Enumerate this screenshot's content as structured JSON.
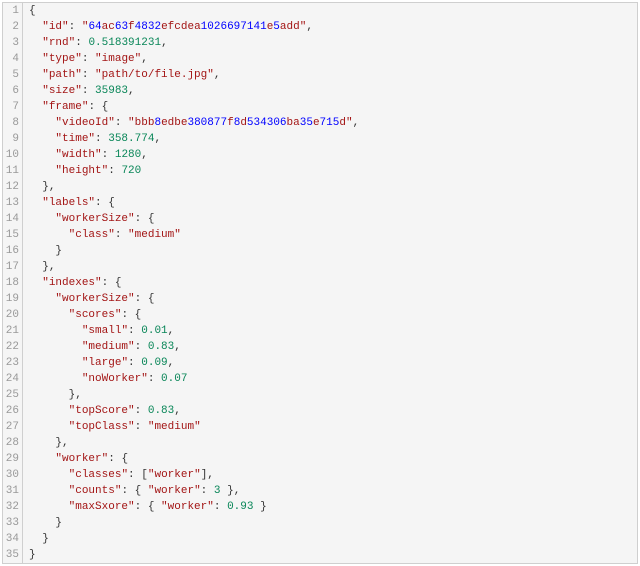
{
  "lines": [
    {
      "indent": 0,
      "tokens": [
        {
          "t": "{",
          "cls": "p"
        }
      ]
    },
    {
      "indent": 1,
      "tokens": [
        {
          "t": "\"",
          "cls": "k"
        },
        {
          "t": "id",
          "cls": "k"
        },
        {
          "t": "\"",
          "cls": "k"
        },
        {
          "t": ": ",
          "cls": "c"
        },
        {
          "t": "\"",
          "cls": "s"
        },
        {
          "t": "64",
          "cls": "hx"
        },
        {
          "t": "ac",
          "cls": "s"
        },
        {
          "t": "63",
          "cls": "hx"
        },
        {
          "t": "f",
          "cls": "s"
        },
        {
          "t": "4832",
          "cls": "hx"
        },
        {
          "t": "efcdea",
          "cls": "s"
        },
        {
          "t": "1026697141",
          "cls": "hx"
        },
        {
          "t": "e",
          "cls": "s"
        },
        {
          "t": "5",
          "cls": "hx"
        },
        {
          "t": "add",
          "cls": "s"
        },
        {
          "t": "\"",
          "cls": "s"
        },
        {
          "t": ",",
          "cls": "p"
        }
      ]
    },
    {
      "indent": 1,
      "tokens": [
        {
          "t": "\"",
          "cls": "k"
        },
        {
          "t": "rnd",
          "cls": "k"
        },
        {
          "t": "\"",
          "cls": "k"
        },
        {
          "t": ": ",
          "cls": "c"
        },
        {
          "t": "0.518391231",
          "cls": "n"
        },
        {
          "t": ",",
          "cls": "p"
        }
      ]
    },
    {
      "indent": 1,
      "tokens": [
        {
          "t": "\"",
          "cls": "k"
        },
        {
          "t": "type",
          "cls": "k"
        },
        {
          "t": "\"",
          "cls": "k"
        },
        {
          "t": ": ",
          "cls": "c"
        },
        {
          "t": "\"",
          "cls": "s"
        },
        {
          "t": "image",
          "cls": "s"
        },
        {
          "t": "\"",
          "cls": "s"
        },
        {
          "t": ",",
          "cls": "p"
        }
      ]
    },
    {
      "indent": 1,
      "tokens": [
        {
          "t": "\"",
          "cls": "k"
        },
        {
          "t": "path",
          "cls": "k"
        },
        {
          "t": "\"",
          "cls": "k"
        },
        {
          "t": ": ",
          "cls": "c"
        },
        {
          "t": "\"",
          "cls": "s"
        },
        {
          "t": "path/to/file.jpg",
          "cls": "s"
        },
        {
          "t": "\"",
          "cls": "s"
        },
        {
          "t": ",",
          "cls": "p"
        }
      ]
    },
    {
      "indent": 1,
      "tokens": [
        {
          "t": "\"",
          "cls": "k"
        },
        {
          "t": "size",
          "cls": "k"
        },
        {
          "t": "\"",
          "cls": "k"
        },
        {
          "t": ": ",
          "cls": "c"
        },
        {
          "t": "35983",
          "cls": "n"
        },
        {
          "t": ",",
          "cls": "p"
        }
      ]
    },
    {
      "indent": 1,
      "tokens": [
        {
          "t": "\"",
          "cls": "k"
        },
        {
          "t": "frame",
          "cls": "k"
        },
        {
          "t": "\"",
          "cls": "k"
        },
        {
          "t": ": ",
          "cls": "c"
        },
        {
          "t": "{",
          "cls": "p"
        }
      ]
    },
    {
      "indent": 2,
      "tokens": [
        {
          "t": "\"",
          "cls": "k"
        },
        {
          "t": "videoId",
          "cls": "k"
        },
        {
          "t": "\"",
          "cls": "k"
        },
        {
          "t": ": ",
          "cls": "c"
        },
        {
          "t": "\"",
          "cls": "s"
        },
        {
          "t": "bbb",
          "cls": "s"
        },
        {
          "t": "8",
          "cls": "hx"
        },
        {
          "t": "edbe",
          "cls": "s"
        },
        {
          "t": "380877",
          "cls": "hx"
        },
        {
          "t": "f",
          "cls": "s"
        },
        {
          "t": "8",
          "cls": "hx"
        },
        {
          "t": "d",
          "cls": "s"
        },
        {
          "t": "534306",
          "cls": "hx"
        },
        {
          "t": "ba",
          "cls": "s"
        },
        {
          "t": "35",
          "cls": "hx"
        },
        {
          "t": "e",
          "cls": "s"
        },
        {
          "t": "715",
          "cls": "hx"
        },
        {
          "t": "d",
          "cls": "s"
        },
        {
          "t": "\"",
          "cls": "s"
        },
        {
          "t": ",",
          "cls": "p"
        }
      ]
    },
    {
      "indent": 2,
      "tokens": [
        {
          "t": "\"",
          "cls": "k"
        },
        {
          "t": "time",
          "cls": "k"
        },
        {
          "t": "\"",
          "cls": "k"
        },
        {
          "t": ": ",
          "cls": "c"
        },
        {
          "t": "358.774",
          "cls": "n"
        },
        {
          "t": ",",
          "cls": "p"
        }
      ]
    },
    {
      "indent": 2,
      "tokens": [
        {
          "t": "\"",
          "cls": "k"
        },
        {
          "t": "width",
          "cls": "k"
        },
        {
          "t": "\"",
          "cls": "k"
        },
        {
          "t": ": ",
          "cls": "c"
        },
        {
          "t": "1280",
          "cls": "n"
        },
        {
          "t": ",",
          "cls": "p"
        }
      ]
    },
    {
      "indent": 2,
      "tokens": [
        {
          "t": "\"",
          "cls": "k"
        },
        {
          "t": "height",
          "cls": "k"
        },
        {
          "t": "\"",
          "cls": "k"
        },
        {
          "t": ": ",
          "cls": "c"
        },
        {
          "t": "720",
          "cls": "n"
        }
      ]
    },
    {
      "indent": 1,
      "tokens": [
        {
          "t": "}",
          "cls": "p"
        },
        {
          "t": ",",
          "cls": "p"
        }
      ]
    },
    {
      "indent": 1,
      "tokens": [
        {
          "t": "\"",
          "cls": "k"
        },
        {
          "t": "labels",
          "cls": "k"
        },
        {
          "t": "\"",
          "cls": "k"
        },
        {
          "t": ": ",
          "cls": "c"
        },
        {
          "t": "{",
          "cls": "p"
        }
      ]
    },
    {
      "indent": 2,
      "tokens": [
        {
          "t": "\"",
          "cls": "k"
        },
        {
          "t": "workerSize",
          "cls": "k"
        },
        {
          "t": "\"",
          "cls": "k"
        },
        {
          "t": ": ",
          "cls": "c"
        },
        {
          "t": "{",
          "cls": "p"
        }
      ]
    },
    {
      "indent": 3,
      "tokens": [
        {
          "t": "\"",
          "cls": "k"
        },
        {
          "t": "class",
          "cls": "k"
        },
        {
          "t": "\"",
          "cls": "k"
        },
        {
          "t": ": ",
          "cls": "c"
        },
        {
          "t": "\"",
          "cls": "s"
        },
        {
          "t": "medium",
          "cls": "s"
        },
        {
          "t": "\"",
          "cls": "s"
        }
      ]
    },
    {
      "indent": 2,
      "tokens": [
        {
          "t": "}",
          "cls": "p"
        }
      ]
    },
    {
      "indent": 1,
      "tokens": [
        {
          "t": "}",
          "cls": "p"
        },
        {
          "t": ",",
          "cls": "p"
        }
      ]
    },
    {
      "indent": 1,
      "tokens": [
        {
          "t": "\"",
          "cls": "k"
        },
        {
          "t": "indexes",
          "cls": "k"
        },
        {
          "t": "\"",
          "cls": "k"
        },
        {
          "t": ": ",
          "cls": "c"
        },
        {
          "t": "{",
          "cls": "p"
        }
      ]
    },
    {
      "indent": 2,
      "tokens": [
        {
          "t": "\"",
          "cls": "k"
        },
        {
          "t": "workerSize",
          "cls": "k"
        },
        {
          "t": "\"",
          "cls": "k"
        },
        {
          "t": ": ",
          "cls": "c"
        },
        {
          "t": "{",
          "cls": "p"
        }
      ]
    },
    {
      "indent": 3,
      "tokens": [
        {
          "t": "\"",
          "cls": "k"
        },
        {
          "t": "scores",
          "cls": "k"
        },
        {
          "t": "\"",
          "cls": "k"
        },
        {
          "t": ": ",
          "cls": "c"
        },
        {
          "t": "{",
          "cls": "p"
        }
      ]
    },
    {
      "indent": 4,
      "tokens": [
        {
          "t": "\"",
          "cls": "k"
        },
        {
          "t": "small",
          "cls": "k"
        },
        {
          "t": "\"",
          "cls": "k"
        },
        {
          "t": ": ",
          "cls": "c"
        },
        {
          "t": "0.01",
          "cls": "n"
        },
        {
          "t": ",",
          "cls": "p"
        }
      ]
    },
    {
      "indent": 4,
      "tokens": [
        {
          "t": "\"",
          "cls": "k"
        },
        {
          "t": "medium",
          "cls": "k"
        },
        {
          "t": "\"",
          "cls": "k"
        },
        {
          "t": ": ",
          "cls": "c"
        },
        {
          "t": "0.83",
          "cls": "n"
        },
        {
          "t": ",",
          "cls": "p"
        }
      ]
    },
    {
      "indent": 4,
      "tokens": [
        {
          "t": "\"",
          "cls": "k"
        },
        {
          "t": "large",
          "cls": "k"
        },
        {
          "t": "\"",
          "cls": "k"
        },
        {
          "t": ": ",
          "cls": "c"
        },
        {
          "t": "0.09",
          "cls": "n"
        },
        {
          "t": ",",
          "cls": "p"
        }
      ]
    },
    {
      "indent": 4,
      "tokens": [
        {
          "t": "\"",
          "cls": "k"
        },
        {
          "t": "noWorker",
          "cls": "k"
        },
        {
          "t": "\"",
          "cls": "k"
        },
        {
          "t": ": ",
          "cls": "c"
        },
        {
          "t": "0.07",
          "cls": "n"
        }
      ]
    },
    {
      "indent": 3,
      "tokens": [
        {
          "t": "}",
          "cls": "p"
        },
        {
          "t": ",",
          "cls": "p"
        }
      ]
    },
    {
      "indent": 3,
      "tokens": [
        {
          "t": "\"",
          "cls": "k"
        },
        {
          "t": "topScore",
          "cls": "k"
        },
        {
          "t": "\"",
          "cls": "k"
        },
        {
          "t": ": ",
          "cls": "c"
        },
        {
          "t": "0.83",
          "cls": "n"
        },
        {
          "t": ",",
          "cls": "p"
        }
      ]
    },
    {
      "indent": 3,
      "tokens": [
        {
          "t": "\"",
          "cls": "k"
        },
        {
          "t": "topClass",
          "cls": "k"
        },
        {
          "t": "\"",
          "cls": "k"
        },
        {
          "t": ": ",
          "cls": "c"
        },
        {
          "t": "\"",
          "cls": "s"
        },
        {
          "t": "medium",
          "cls": "s"
        },
        {
          "t": "\"",
          "cls": "s"
        }
      ]
    },
    {
      "indent": 2,
      "tokens": [
        {
          "t": "}",
          "cls": "p"
        },
        {
          "t": ",",
          "cls": "p"
        }
      ]
    },
    {
      "indent": 2,
      "tokens": [
        {
          "t": "\"",
          "cls": "k"
        },
        {
          "t": "worker",
          "cls": "k"
        },
        {
          "t": "\"",
          "cls": "k"
        },
        {
          "t": ": ",
          "cls": "c"
        },
        {
          "t": "{",
          "cls": "p"
        }
      ]
    },
    {
      "indent": 3,
      "tokens": [
        {
          "t": "\"",
          "cls": "k"
        },
        {
          "t": "classes",
          "cls": "k"
        },
        {
          "t": "\"",
          "cls": "k"
        },
        {
          "t": ": ",
          "cls": "c"
        },
        {
          "t": "[",
          "cls": "p"
        },
        {
          "t": "\"",
          "cls": "s"
        },
        {
          "t": "worker",
          "cls": "s"
        },
        {
          "t": "\"",
          "cls": "s"
        },
        {
          "t": "]",
          "cls": "p"
        },
        {
          "t": ",",
          "cls": "p"
        }
      ]
    },
    {
      "indent": 3,
      "tokens": [
        {
          "t": "\"",
          "cls": "k"
        },
        {
          "t": "counts",
          "cls": "k"
        },
        {
          "t": "\"",
          "cls": "k"
        },
        {
          "t": ": ",
          "cls": "c"
        },
        {
          "t": "{ ",
          "cls": "p"
        },
        {
          "t": "\"",
          "cls": "k"
        },
        {
          "t": "worker",
          "cls": "k"
        },
        {
          "t": "\"",
          "cls": "k"
        },
        {
          "t": ": ",
          "cls": "c"
        },
        {
          "t": "3",
          "cls": "n"
        },
        {
          "t": " }",
          "cls": "p"
        },
        {
          "t": ",",
          "cls": "p"
        }
      ]
    },
    {
      "indent": 3,
      "tokens": [
        {
          "t": "\"",
          "cls": "k"
        },
        {
          "t": "maxSxore",
          "cls": "k"
        },
        {
          "t": "\"",
          "cls": "k"
        },
        {
          "t": ": ",
          "cls": "c"
        },
        {
          "t": "{ ",
          "cls": "p"
        },
        {
          "t": "\"",
          "cls": "k"
        },
        {
          "t": "worker",
          "cls": "k"
        },
        {
          "t": "\"",
          "cls": "k"
        },
        {
          "t": ": ",
          "cls": "c"
        },
        {
          "t": "0.93",
          "cls": "n"
        },
        {
          "t": " }",
          "cls": "p"
        }
      ]
    },
    {
      "indent": 2,
      "tokens": [
        {
          "t": "}",
          "cls": "p"
        }
      ]
    },
    {
      "indent": 1,
      "tokens": [
        {
          "t": "}",
          "cls": "p"
        }
      ]
    },
    {
      "indent": 0,
      "tokens": [
        {
          "t": "}",
          "cls": "p"
        }
      ]
    }
  ]
}
